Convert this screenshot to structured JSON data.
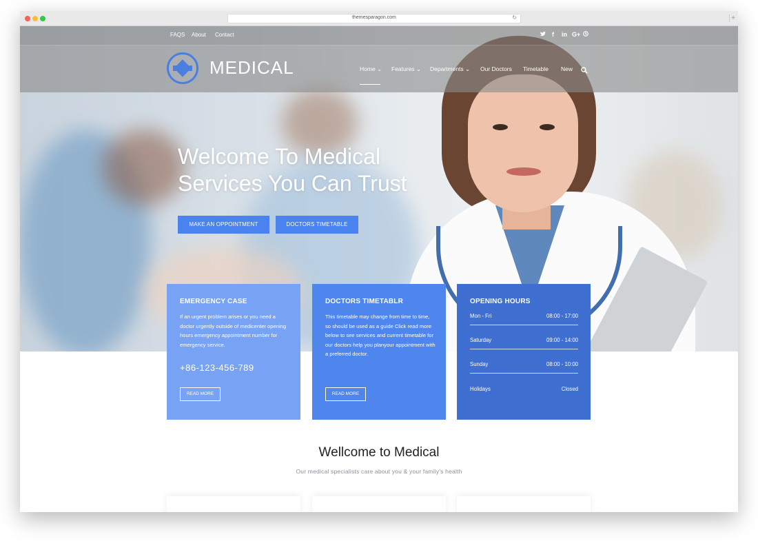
{
  "browser": {
    "url": "themesparagon.com"
  },
  "topbar": {
    "links": [
      "FAQS",
      "About",
      "Contact"
    ],
    "social": [
      "twitter-icon",
      "facebook-icon",
      "linkedin-icon",
      "google-plus-icon",
      "skype-icon"
    ]
  },
  "brand": {
    "name": "MEDICAL"
  },
  "nav": {
    "items": [
      "Home",
      "Features",
      "Departments",
      "Our Doctors",
      "Timetable",
      "New"
    ],
    "dropdown_marker": "⌄"
  },
  "hero": {
    "title_line1": "Welcome To Medical",
    "title_line2": "Services You Can Trust",
    "btn_appointment": "MAKE AN OPPOINTMENT",
    "btn_timetable": "DOCTORS TIMETABLE"
  },
  "cards": {
    "emergency": {
      "title": "EMERGENCY CASE",
      "body": "If an urgent problem arises or you need a doctor urgently outside of medicenter opening hours emergency appointment number for emergency service.",
      "phone": "+86-123-456-789",
      "button": "READ MORE"
    },
    "timetable": {
      "title": "DOCTORS TIMETABLR",
      "body": "This timetable may change from time to time, so should be used as a guide Click read more below to see services and current timetable for our doctors help you planyour appointment with a preferred doctor.",
      "button": "READ MORE"
    },
    "hours": {
      "title": "OPENING HOURS",
      "rows": [
        {
          "day": "Mon - Fri",
          "time": "08:00 - 17:00"
        },
        {
          "day": "Saturday",
          "time": "09:00 - 14:00"
        },
        {
          "day": "Sunday",
          "time": "08:00 - 10:00"
        },
        {
          "day": "Holidays",
          "time": "Closed"
        }
      ]
    }
  },
  "welcome": {
    "title": "Wellcome to Medical",
    "subtitle": "Our medical specialists care about you & your family's health"
  },
  "colors": {
    "accent": "#4a82f0",
    "card1": "#78a3f5",
    "card2": "#4f86ee",
    "card3": "#3f6fd0"
  }
}
